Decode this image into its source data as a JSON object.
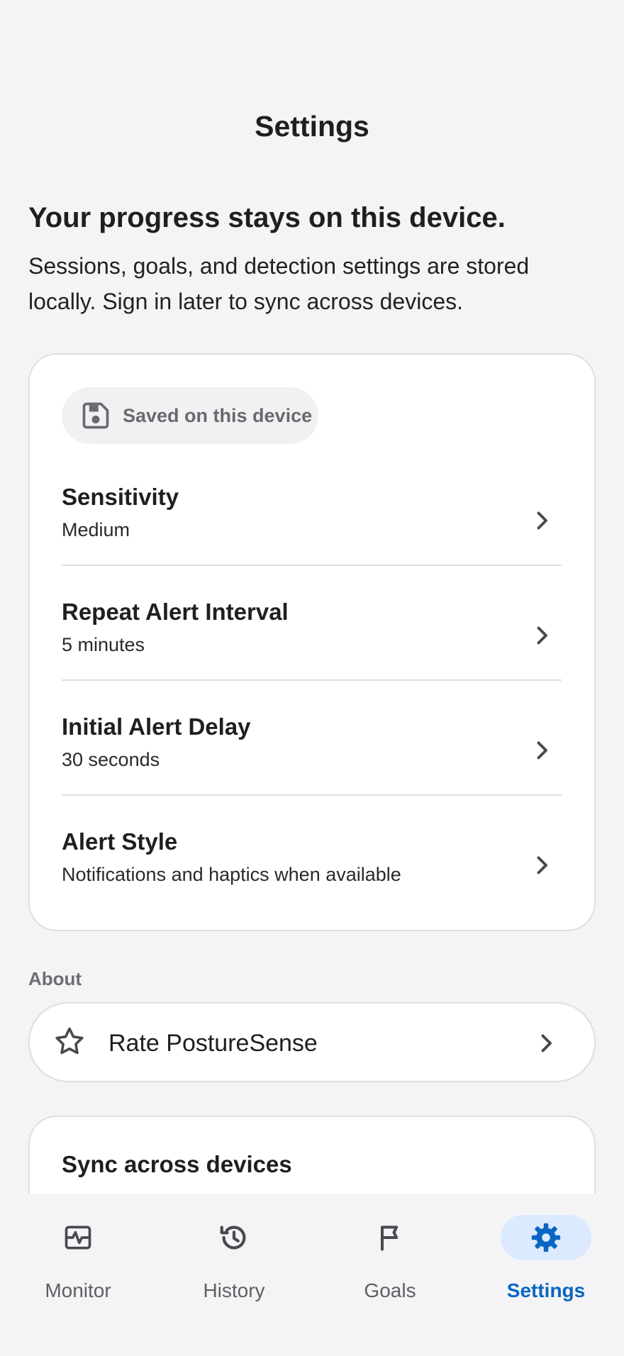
{
  "header": {
    "title": "Settings"
  },
  "intro": {
    "heading": "Your progress stays on this device.",
    "text": "Sessions, goals, and detection settings are stored locally. Sign in later to sync across devices."
  },
  "storage_badge": {
    "label": "Saved on this device",
    "icon": "floppy-disk-icon"
  },
  "settings": [
    {
      "title": "Sensitivity",
      "value": "Medium"
    },
    {
      "title": "Repeat Alert Interval",
      "value": "5 minutes"
    },
    {
      "title": "Initial Alert Delay",
      "value": "30 seconds"
    },
    {
      "title": "Alert Style",
      "value": "Notifications and haptics when available"
    }
  ],
  "about": {
    "section_label": "About",
    "rate_label": "Rate PostureSense",
    "rate_icon": "star-icon"
  },
  "sync": {
    "title": "Sync across devices"
  },
  "nav": {
    "items": [
      {
        "label": "Monitor",
        "icon": "monitor-icon"
      },
      {
        "label": "History",
        "icon": "history-icon"
      },
      {
        "label": "Goals",
        "icon": "flag-icon"
      },
      {
        "label": "Settings",
        "icon": "gear-icon"
      }
    ],
    "active": "Settings"
  },
  "colors": {
    "accent": "#0a66c2",
    "accent_bg": "#dbeafe",
    "background": "#f4f4f6",
    "card": "#ffffff"
  }
}
